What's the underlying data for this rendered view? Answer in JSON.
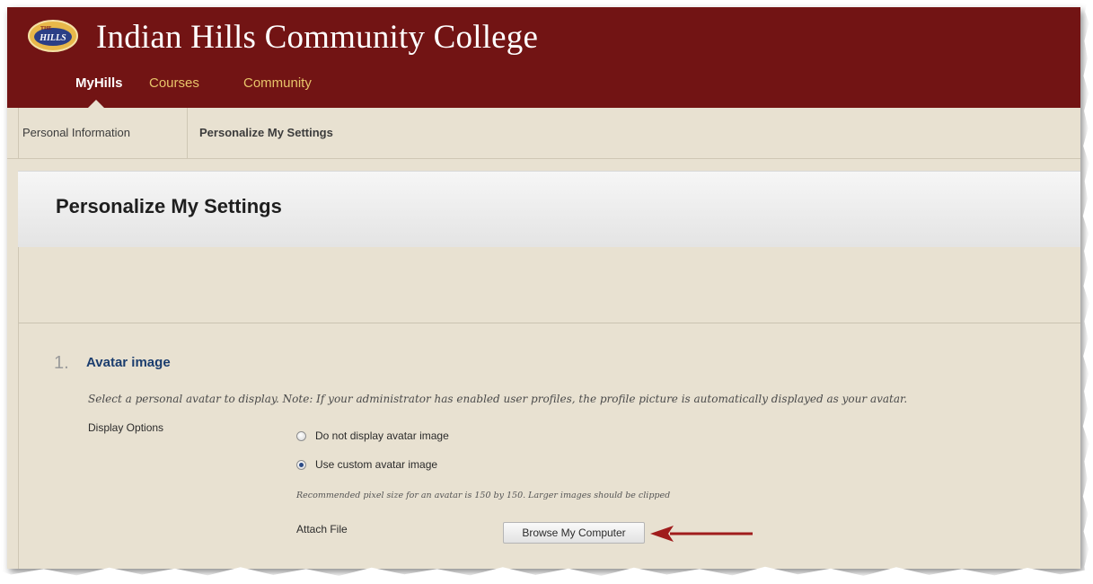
{
  "header": {
    "logo_text": "THE HILLS",
    "college_name": "Indian Hills Community College",
    "tabs": [
      {
        "label": "MyHills",
        "active": true
      },
      {
        "label": "Courses",
        "active": false
      },
      {
        "label": "Community",
        "active": false
      }
    ]
  },
  "subnav": {
    "items": [
      {
        "label": "Personal Information",
        "active": false
      },
      {
        "label": "Personalize My Settings",
        "active": true
      }
    ]
  },
  "page": {
    "title": "Personalize My Settings"
  },
  "section": {
    "number": "1.",
    "title": "Avatar image",
    "instructions": "Select a personal avatar to display. Note: If your administrator has enabled user profiles, the profile picture is automatically displayed as your avatar.",
    "display_options_label": "Display Options",
    "options": [
      {
        "label": "Do not display avatar image",
        "checked": false
      },
      {
        "label": "Use custom avatar image",
        "checked": true
      }
    ],
    "recommendation": "Recommended pixel size for an avatar is 150 by 150. Larger images should be clipped",
    "attach_label": "Attach File",
    "browse_button": "Browse My Computer"
  },
  "colors": {
    "header_bg": "#721414",
    "tab_inactive": "#e8c46a",
    "page_bg": "#e8e1d1",
    "section_title": "#1b3d6e",
    "arrow": "#a01c1c"
  }
}
